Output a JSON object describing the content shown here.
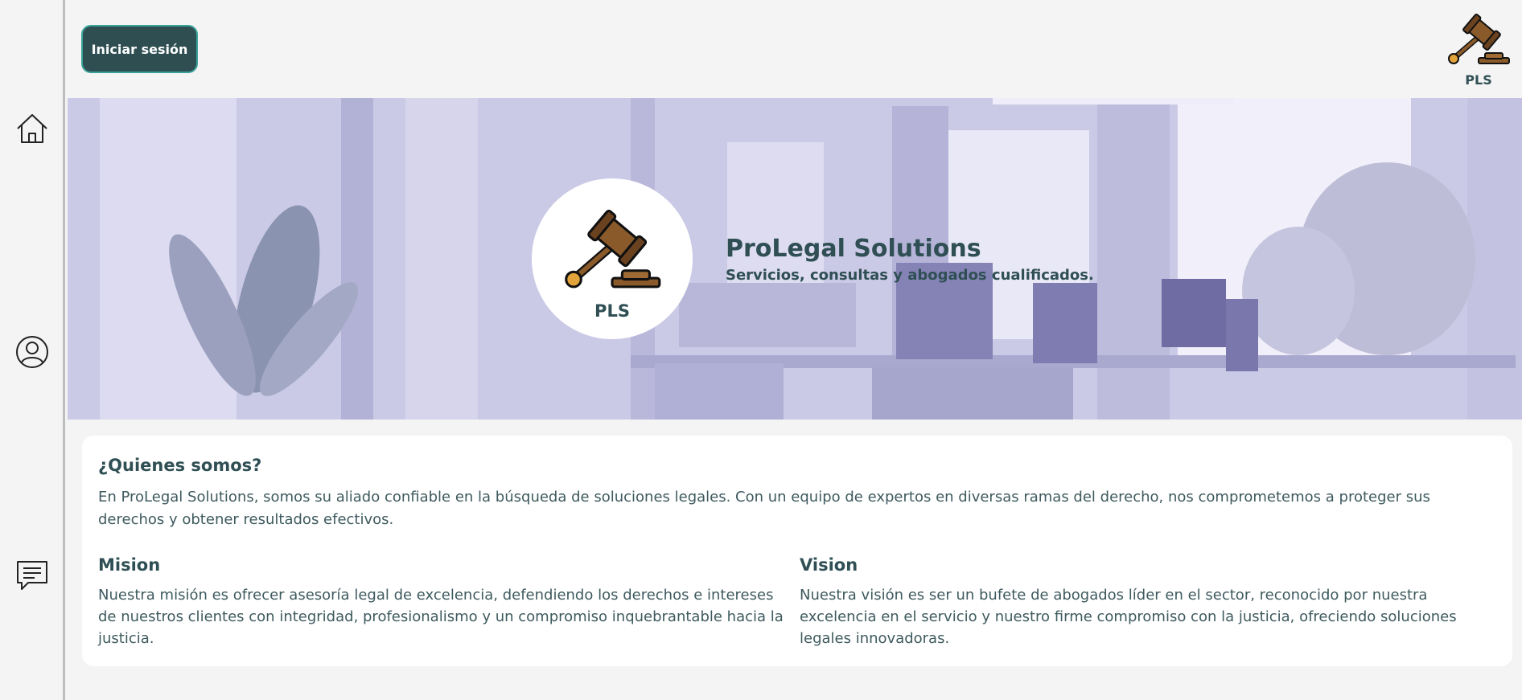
{
  "header": {
    "login_label": "Iniciar sesión",
    "logo_text": "PLS"
  },
  "sidebar": {
    "items": [
      {
        "icon": "home-icon"
      },
      {
        "icon": "user-profile-icon"
      },
      {
        "icon": "chat-icon"
      }
    ]
  },
  "hero": {
    "logo_text": "PLS",
    "title": "ProLegal Solutions",
    "subtitle": "Servicios, consultas y abogados cualificados."
  },
  "about": {
    "title": "¿Quienes somos?",
    "text": "En ProLegal Solutions, somos su aliado confiable en la búsqueda de soluciones legales. Con un equipo de expertos en diversas ramas del derecho, nos comprometemos a proteger sus derechos y obtener resultados efectivos."
  },
  "mission": {
    "title": "Mision",
    "text": "Nuestra misión es ofrecer asesoría legal de excelencia, defendiendo los derechos e intereses de nuestros clientes con integridad, profesionalismo y un compromiso inquebrantable hacia la justicia."
  },
  "vision": {
    "title": "Vision",
    "text": "Nuestra visión es ser un bufete de abogados líder en el sector, reconocido por nuestra excelencia en el servicio y nuestro firme compromiso con la justicia, ofreciendo soluciones legales innovadoras."
  },
  "colors": {
    "primary": "#2e4e52",
    "accent_border": "#3aa39a",
    "hero_tint": "#c9c8e3",
    "gavel_wood": "#8a5a2b"
  }
}
